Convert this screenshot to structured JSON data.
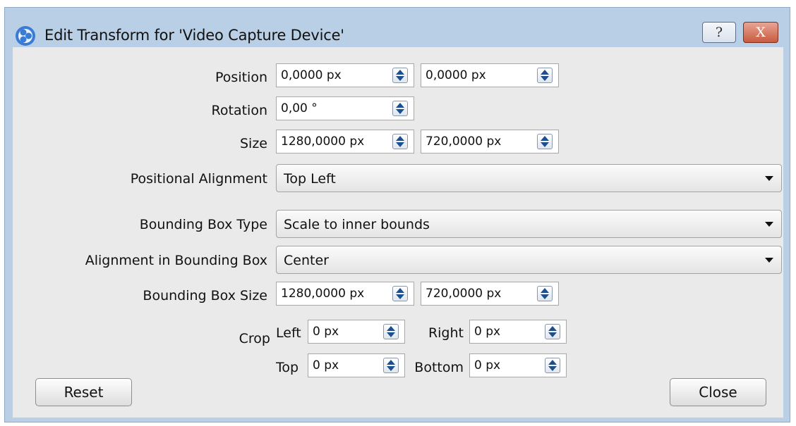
{
  "window": {
    "title": "Edit Transform for 'Video Capture Device'",
    "help_label": "?",
    "close_label": "X"
  },
  "position": {
    "label": "Position",
    "x": "0,0000 px",
    "y": "0,0000 px"
  },
  "rotation": {
    "label": "Rotation",
    "value": "0,00 °"
  },
  "size": {
    "label": "Size",
    "width": "1280,0000 px",
    "height": "720,0000 px"
  },
  "positional_alignment": {
    "label": "Positional Alignment",
    "value": "Top Left"
  },
  "bounding_box_type": {
    "label": "Bounding Box Type",
    "value": "Scale to inner bounds"
  },
  "alignment_in_bounding_box": {
    "label": "Alignment in Bounding Box",
    "value": "Center"
  },
  "bounding_box_size": {
    "label": "Bounding Box Size",
    "width": "1280,0000 px",
    "height": "720,0000 px"
  },
  "crop": {
    "label": "Crop",
    "left_label": "Left",
    "left": "0 px",
    "right_label": "Right",
    "right": "0 px",
    "top_label": "Top",
    "top": "0 px",
    "bottom_label": "Bottom",
    "bottom": "0 px"
  },
  "buttons": {
    "reset": "Reset",
    "close": "Close"
  },
  "colors": {
    "frame": "#b8cfe6",
    "client": "#eaeaea",
    "close_button": "#c85a40",
    "spin_arrow": "#1b4f8f"
  }
}
